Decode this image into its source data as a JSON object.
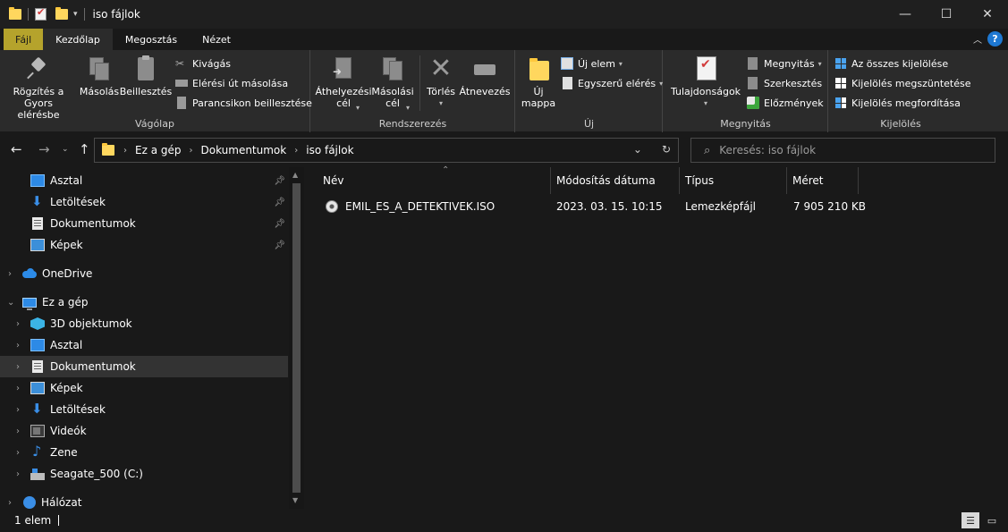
{
  "window": {
    "title": "iso fájlok",
    "minimize": "—",
    "maximize": "☐",
    "close": "✕"
  },
  "ribbon_tabs": [
    {
      "label": "Fájl"
    },
    {
      "label": "Kezdőlap"
    },
    {
      "label": "Megosztás"
    },
    {
      "label": "Nézet"
    }
  ],
  "help_label": "?",
  "ribbon": {
    "clipboard": {
      "label": "Vágólap",
      "pin_line1": "Rögzítés a",
      "pin_line2": "Gyors elérésbe",
      "copy": "Másolás",
      "paste": "Beillesztés",
      "cut": "Kivágás",
      "copy_path": "Elérési út másolása",
      "paste_shortcut": "Parancsikon beillesztése"
    },
    "organize": {
      "label": "Rendszerezés",
      "move_line1": "Áthelyezési",
      "move_line2": "cél",
      "copyto_line1": "Másolási",
      "copyto_line2": "cél",
      "delete": "Törlés",
      "rename": "Átnevezés"
    },
    "new": {
      "label": "Új",
      "new_folder_line1": "Új",
      "new_folder_line2": "mappa",
      "new_item": "Új elem",
      "easy_access": "Egyszerű elérés"
    },
    "open": {
      "label": "Megnyitás",
      "properties": "Tulajdonságok",
      "open": "Megnyitás",
      "edit": "Szerkesztés",
      "history": "Előzmények"
    },
    "select": {
      "label": "Kijelölés",
      "select_all": "Az összes kijelölése",
      "select_none": "Kijelölés megszüntetése",
      "invert": "Kijelölés megfordítása"
    }
  },
  "address": {
    "crumbs": [
      "Ez a gép",
      "Dokumentumok",
      "iso fájlok"
    ]
  },
  "search": {
    "placeholder": "Keresés: iso fájlok"
  },
  "nav": {
    "quick_access": [
      {
        "label": "Asztal",
        "icon": "desktop-icon"
      },
      {
        "label": "Letöltések",
        "icon": "downloads-icon"
      },
      {
        "label": "Dokumentumok",
        "icon": "documents-icon"
      },
      {
        "label": "Képek",
        "icon": "pictures-icon"
      }
    ],
    "onedrive": "OneDrive",
    "this_pc": "Ez a gép",
    "pc_items": [
      {
        "label": "3D objektumok",
        "icon": "3d-objects-icon"
      },
      {
        "label": "Asztal",
        "icon": "desktop-icon"
      },
      {
        "label": "Dokumentumok",
        "icon": "documents-icon",
        "selected": true
      },
      {
        "label": "Képek",
        "icon": "pictures-icon"
      },
      {
        "label": "Letöltések",
        "icon": "downloads-icon"
      },
      {
        "label": "Videók",
        "icon": "videos-icon"
      },
      {
        "label": "Zene",
        "icon": "music-icon"
      },
      {
        "label": "Seagate_500 (C:)",
        "icon": "drive-icon"
      }
    ],
    "network": "Hálózat"
  },
  "columns": [
    "Név",
    "Módosítás dátuma",
    "Típus",
    "Méret"
  ],
  "files": [
    {
      "name": "EMIL_ES_A_DETEKTIVEK.ISO",
      "modified": "2023. 03. 15. 10:15",
      "type": "Lemezképfájl",
      "size": "7 905 210 KB",
      "icon": "disc-image-icon"
    }
  ],
  "status": {
    "count": "1 elem"
  }
}
